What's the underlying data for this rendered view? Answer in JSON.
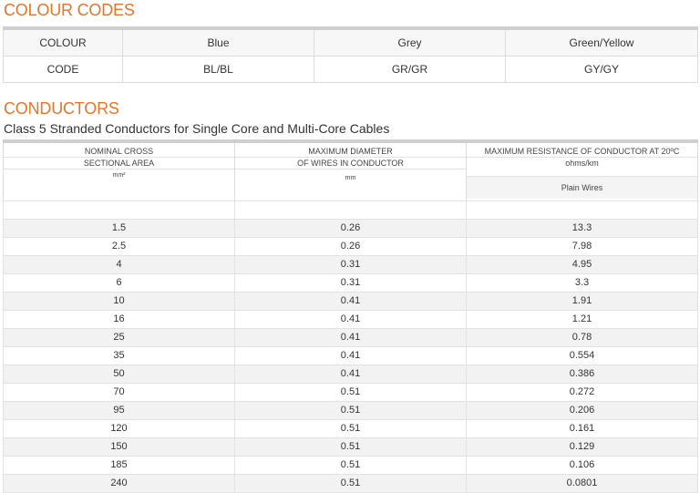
{
  "colour_codes": {
    "title": "COLOUR CODES",
    "row_colour": {
      "label": "COLOUR",
      "values": [
        "Blue",
        "Grey",
        "Green/Yellow"
      ]
    },
    "row_code": {
      "label": "CODE",
      "values": [
        "BL/BL",
        "GR/GR",
        "GY/GY"
      ]
    }
  },
  "conductors": {
    "title": "CONDUCTORS",
    "subtitle": "Class 5 Stranded Conductors for Single Core and Multi-Core Cables",
    "headers": {
      "col1": {
        "line1": "NOMINAL CROSS",
        "line2": "SECTIONAL AREA",
        "unit": "mm²"
      },
      "col2": {
        "line1": "MAXIMUM DIAMETER",
        "line2": "OF WIRES IN CONDUCTOR",
        "unit": "mm"
      },
      "col3": {
        "line1": "MAXIMUM RESISTANCE OF CONDUCTOR AT 20ºC",
        "line2": "ohms/km",
        "sub": "Plain Wires"
      }
    },
    "rows": [
      [
        "1.5",
        "0.26",
        "13.3"
      ],
      [
        "2.5",
        "0.26",
        "7.98"
      ],
      [
        "4",
        "0.31",
        "4.95"
      ],
      [
        "6",
        "0.31",
        "3.3"
      ],
      [
        "10",
        "0.41",
        "1.91"
      ],
      [
        "16",
        "0.41",
        "1.21"
      ],
      [
        "25",
        "0.41",
        "0.78"
      ],
      [
        "35",
        "0.41",
        "0.554"
      ],
      [
        "50",
        "0.41",
        "0.386"
      ],
      [
        "70",
        "0.51",
        "0.272"
      ],
      [
        "95",
        "0.51",
        "0.206"
      ],
      [
        "120",
        "0.51",
        "0.161"
      ],
      [
        "150",
        "0.51",
        "0.129"
      ],
      [
        "185",
        "0.51",
        "0.106"
      ],
      [
        "240",
        "0.51",
        "0.0801"
      ]
    ]
  },
  "colors": {
    "accent": "#e8742a",
    "rule": "#cfcfcf",
    "stripe": "#f2f2f2"
  }
}
